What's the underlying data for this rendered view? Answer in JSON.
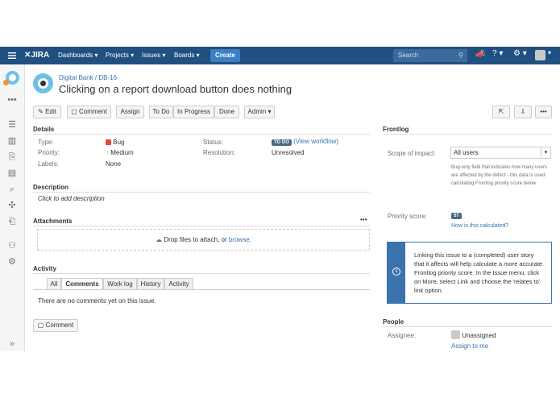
{
  "topbar": {
    "logo": "JIRA",
    "nav": [
      "Dashboards",
      "Projects",
      "Issues",
      "Boards"
    ],
    "create_label": "Create",
    "search_placeholder": "Search"
  },
  "breadcrumb": {
    "project": "Digital Bank",
    "separator": "/",
    "key": "DB-16"
  },
  "issue": {
    "title": "Clicking on a report download button does nothing"
  },
  "toolbar": {
    "edit": "Edit",
    "comment": "Comment",
    "assign": "Assign",
    "todo": "To Do",
    "in_progress": "In Progress",
    "done": "Done",
    "admin": "Admin",
    "more": "•••"
  },
  "details": {
    "heading": "Details",
    "type_label": "Type:",
    "type_value": "Bug",
    "priority_label": "Priority:",
    "priority_value": "Medium",
    "labels_label": "Labels:",
    "labels_value": "None",
    "status_label": "Status:",
    "status_value": "TO DO",
    "view_workflow": "(View workflow)",
    "resolution_label": "Resolution:",
    "resolution_value": "Unresolved"
  },
  "description": {
    "heading": "Description",
    "placeholder": "Click to add description"
  },
  "attachments": {
    "heading": "Attachments",
    "drop_text": "Drop files to attach, or",
    "browse": "browse.",
    "more": "•••"
  },
  "activity": {
    "heading": "Activity",
    "tabs": [
      "All",
      "Comments",
      "Work log",
      "History",
      "Activity"
    ],
    "active_tab": "Comments",
    "empty": "There are no comments yet on this issue.",
    "comment_button": "Comment"
  },
  "frontlog": {
    "heading": "Frontlog",
    "scope_label": "Scope of impact:",
    "scope_value": "All users",
    "scope_help": "Bug-only field that indicates how many users are affected by the defect - this data is used calculating Frontlog priority score below",
    "priority_label": "Priority score:",
    "priority_value": "57",
    "how_link": "How is this calculated?",
    "info": "Linking this issue to a (completed) user story that it affects will help calculate a more accurate Frontlog priority score. In the Issue menu, click on More, select Link and choose the 'relates to' link option."
  },
  "people": {
    "heading": "People",
    "assignee_label": "Assignee:",
    "assignee_value": "Unassigned",
    "assign_to_me": "Assign to me"
  },
  "colors": {
    "topbar": "#205081",
    "create": "#3b7fc4",
    "link": "#3572b0",
    "status": "#4a6785",
    "bug": "#e5493a",
    "info": "#3b73af"
  }
}
